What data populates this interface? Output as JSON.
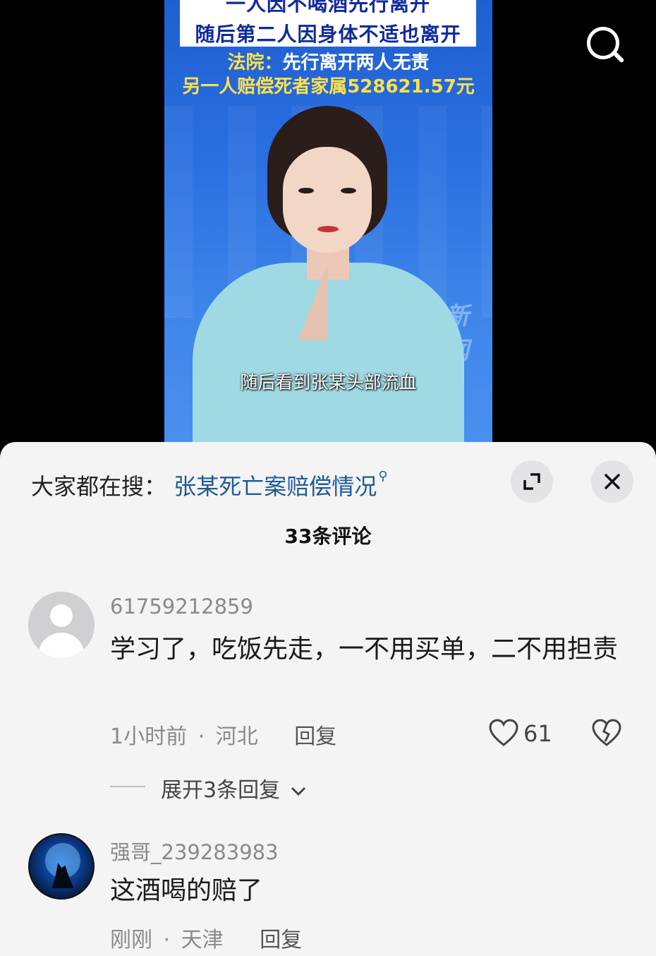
{
  "video": {
    "headline_line1": "一人因不喝酒先行离开",
    "headline_line2": "随后第二人因身体不适也离开",
    "verdict_label": "法院：",
    "verdict_rest": "先行离开两人无责",
    "verdict_line2": "另一人赔偿死者家属528621.57元",
    "subtitle": "随后看到张某头部流血",
    "bg_logo": "新闻"
  },
  "sheet": {
    "trending_prefix": "大家都在搜：",
    "trending_query": "张某死亡案赔偿情况",
    "comment_count": "33条评论"
  },
  "comments": [
    {
      "username": "61759212859",
      "text": "学习了，吃饭先走，一不用买单，二不用担责",
      "time": "1小时前",
      "location": "河北",
      "reply_label": "回复",
      "likes": "61",
      "expand_replies": "展开3条回复"
    },
    {
      "username": "强哥_239283983",
      "text": "这酒喝的赔了",
      "time": "刚刚",
      "location": "天津",
      "reply_label": "回复"
    }
  ],
  "icons": {
    "search": "search-icon",
    "expand": "expand-icon",
    "close": "close-icon",
    "like": "heart-icon",
    "dislike": "broken-heart-icon",
    "chevron": "chevron-down-icon"
  }
}
